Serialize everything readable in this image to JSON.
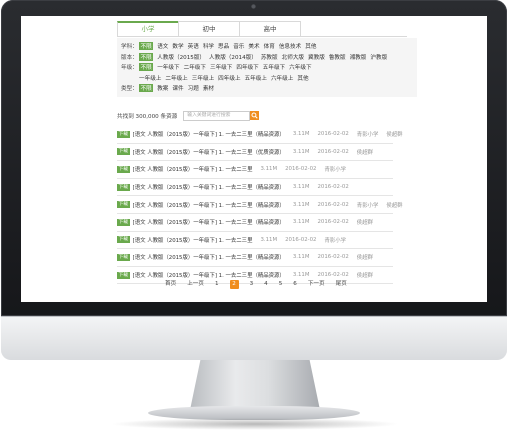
{
  "tabs": [
    {
      "label": "小学",
      "active": true
    },
    {
      "label": "初中",
      "active": false
    },
    {
      "label": "高中",
      "active": false
    }
  ],
  "filters": [
    {
      "label": "学科：",
      "options": [
        {
          "text": "不限",
          "selected": true
        },
        {
          "text": "语文"
        },
        {
          "text": "数学"
        },
        {
          "text": "英语"
        },
        {
          "text": "科学"
        },
        {
          "text": "思品"
        },
        {
          "text": "音乐"
        },
        {
          "text": "美术"
        },
        {
          "text": "体育"
        },
        {
          "text": "信息技术"
        },
        {
          "text": "其他"
        }
      ]
    },
    {
      "label": "版本：",
      "options": [
        {
          "text": "不限",
          "selected": true
        },
        {
          "text": "人教版（2015版）"
        },
        {
          "text": "人教版（2014版）"
        },
        {
          "text": "苏教版"
        },
        {
          "text": "北师大版"
        },
        {
          "text": "冀教版"
        },
        {
          "text": "鲁教版"
        },
        {
          "text": "湘教版"
        },
        {
          "text": "沪教版"
        }
      ]
    },
    {
      "label": "年级：",
      "options": [
        {
          "text": "不限",
          "selected": true
        },
        {
          "text": "一年级下"
        },
        {
          "text": "二年级下"
        },
        {
          "text": "三年级下"
        },
        {
          "text": "四年级下"
        },
        {
          "text": "五年级下"
        },
        {
          "text": "六年级下"
        }
      ]
    },
    {
      "label": "",
      "options": [
        {
          "text": "一年级上"
        },
        {
          "text": "二年级上"
        },
        {
          "text": "三年级上"
        },
        {
          "text": "四年级上"
        },
        {
          "text": "五年级上"
        },
        {
          "text": "六年级上"
        },
        {
          "text": "其他"
        }
      ]
    },
    {
      "label": "类型：",
      "options": [
        {
          "text": "不限",
          "selected": true
        },
        {
          "text": "教案"
        },
        {
          "text": "课件"
        },
        {
          "text": "习题"
        },
        {
          "text": "素材"
        }
      ]
    }
  ],
  "result_count": "共找到 300,000 条资源",
  "search": {
    "placeholder": "输入关键词进行搜索"
  },
  "list": [
    {
      "badge": "下载",
      "title": "[语文 人教版（2015版）一年级下] 1. 一去二三里（精品资源）",
      "size": "3.11M",
      "date": "2016-02-02",
      "author": "青影小学",
      "uploader": "侯超群"
    },
    {
      "badge": "下载",
      "title": "[语文 人教版（2015版）一年级下] 1. 一去二三里（优质资源）",
      "size": "3.11M",
      "date": "2016-02-02",
      "author": "",
      "uploader": "侯超群"
    },
    {
      "badge": "下载",
      "title": "[语文 人教版（2015版）一年级下] 1. 一去二三里",
      "size": "3.11M",
      "date": "2016-02-02",
      "author": "青影小学",
      "uploader": ""
    },
    {
      "badge": "下载",
      "title": "[语文 人教版（2015版）一年级下] 1. 一去二三里（精品资源）",
      "size": "3.11M",
      "date": "2016-02-02",
      "author": "",
      "uploader": ""
    },
    {
      "badge": "下载",
      "title": "[语文 人教版（2015版）一年级下] 1. 一去二三里（精品资源）",
      "size": "3.11M",
      "date": "2016-02-02",
      "author": "青影小学",
      "uploader": "侯超群"
    },
    {
      "badge": "下载",
      "title": "[语文 人教版（2015版）一年级下] 1. 一去二三里（精品资源）",
      "size": "3.11M",
      "date": "2016-02-02",
      "author": "",
      "uploader": "侯超群"
    },
    {
      "badge": "下载",
      "title": "[语文 人教版（2015版）一年级下] 1. 一去二三里",
      "size": "3.11M",
      "date": "2016-02-02",
      "author": "青影小学",
      "uploader": ""
    },
    {
      "badge": "下载",
      "title": "[语文 人教版（2015版）一年级下] 1. 一去二三里（精品资源）",
      "size": "3.11M",
      "date": "2016-02-02",
      "author": "",
      "uploader": "侯超群"
    },
    {
      "badge": "下载",
      "title": "[语文 人教版（2015版）一年级下] 1. 一去二三里（精品资源）",
      "size": "3.11M",
      "date": "2016-02-02",
      "author": "",
      "uploader": "侯超群"
    }
  ],
  "pagination": {
    "first": "首页",
    "prev": "上一页",
    "pages": [
      "1",
      "2",
      "3",
      "4",
      "5",
      "6"
    ],
    "current": "2",
    "next": "下一页",
    "last": "尾页"
  },
  "colors": {
    "accent_green": "#6aa94d",
    "accent_orange": "#f08e1e"
  }
}
